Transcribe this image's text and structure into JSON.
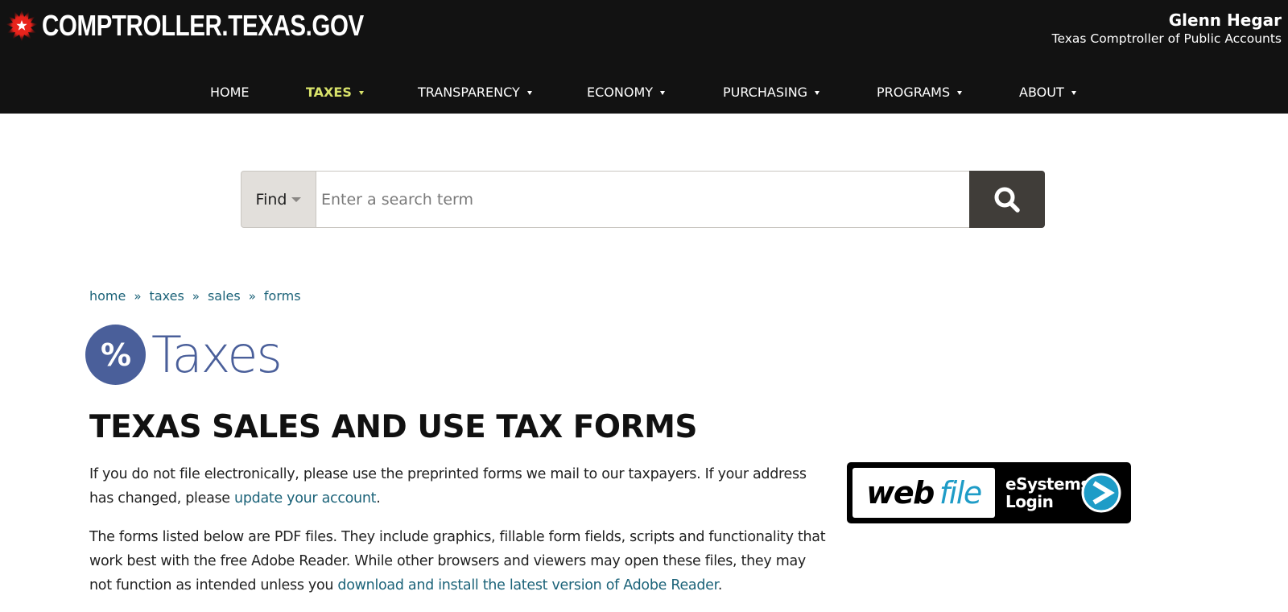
{
  "header": {
    "site_name": "COMPTROLLER.TEXAS.GOV",
    "logo_icon": "starburst-star-icon",
    "official_name": "Glenn Hegar",
    "official_title": "Texas Comptroller of Public Accounts",
    "accent_color": "#d8e26a",
    "background_color": "#121212"
  },
  "nav": {
    "items": [
      {
        "label": "HOME",
        "has_dropdown": false,
        "active": false
      },
      {
        "label": "TAXES",
        "has_dropdown": true,
        "active": true
      },
      {
        "label": "TRANSPARENCY",
        "has_dropdown": true,
        "active": false
      },
      {
        "label": "ECONOMY",
        "has_dropdown": true,
        "active": false
      },
      {
        "label": "PURCHASING",
        "has_dropdown": true,
        "active": false
      },
      {
        "label": "PROGRAMS",
        "has_dropdown": true,
        "active": false
      },
      {
        "label": "ABOUT",
        "has_dropdown": true,
        "active": false
      }
    ]
  },
  "search": {
    "scope_label": "Find",
    "placeholder": "Enter a search term",
    "value": "",
    "button_icon": "search-icon"
  },
  "breadcrumb": {
    "items": [
      "home",
      "taxes",
      "sales",
      "forms"
    ],
    "separator": "»"
  },
  "section": {
    "badge_symbol": "%",
    "title": "Taxes",
    "color": "#4a5f9a"
  },
  "page": {
    "title": "TEXAS SALES AND USE TAX FORMS",
    "paragraph1": {
      "text_before": "If you do not file electronically, please use the preprinted forms we mail to our taxpayers. If your address has changed, please ",
      "link_text": "update your account",
      "text_after": "."
    },
    "paragraph2": {
      "text_before": "The forms listed below are PDF files. They include graphics, fillable form fields, scripts and functionality that work best with the free Adobe Reader. While other browsers and viewers may open these files, they may not function as intended unless you ",
      "link_text": "download and install the latest version of Adobe Reader",
      "text_after": "."
    },
    "link_color": "#1c6379"
  },
  "webfile": {
    "word1": "web",
    "word2": "file",
    "line1": "eSystems",
    "line2": "Login",
    "arrow_icon": "arrow-right-circle-icon",
    "accent_color": "#1e9cc7"
  }
}
